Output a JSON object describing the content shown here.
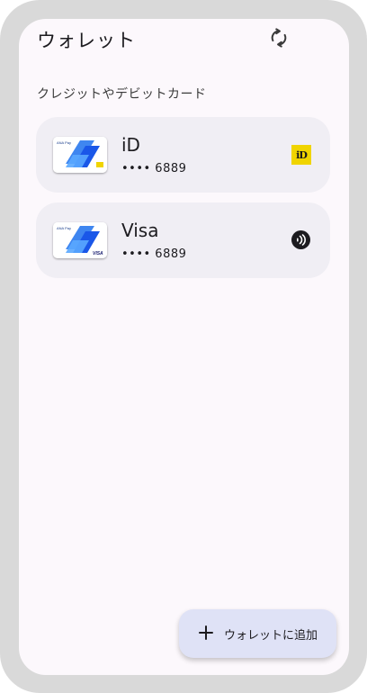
{
  "header": {
    "title": "ウォレット",
    "sync_icon": "sync-icon"
  },
  "section": {
    "label": "クレジットやデビットカード"
  },
  "cards": [
    {
      "name": "iD",
      "number": "•••• 6889",
      "badge": "id-logo",
      "badge_text": "iD"
    },
    {
      "name": "Visa",
      "number": "•••• 6889",
      "badge": "nfc-icon"
    }
  ],
  "thumb": {
    "brand_text": "ANA Pay",
    "network_text": "VISA"
  },
  "fab": {
    "label": "ウォレットに追加",
    "icon": "plus-icon"
  },
  "colors": {
    "background": "#fcf8fc",
    "card": "#f0eef4",
    "fab": "#dfe2f6",
    "card_art_blue": "#1a57e8",
    "id_badge": "#f0d400"
  }
}
